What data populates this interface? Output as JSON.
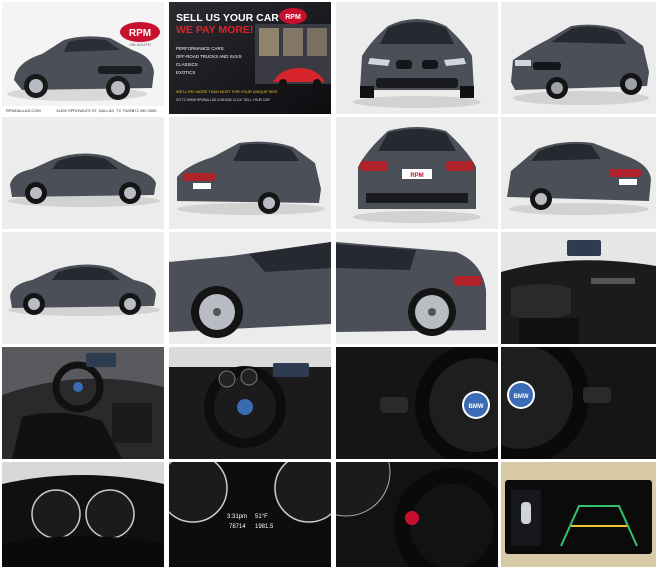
{
  "dealer": {
    "logo_text": "RPM",
    "logo_sub": "ON SOUTH",
    "website": "RPMDALLAS.COM",
    "address": "11450 SPROWLES ST, DALLAS, TX 75229",
    "phone": "972 490 0000"
  },
  "ad": {
    "headline_1": "SELL US YOUR CAR",
    "headline_2": "WE PAY MORE!",
    "categories": [
      "PERFORMANCE CARS",
      "OFF-ROAD TRUCKS AND SUVS",
      "CLASSICS",
      "EXOTICS"
    ],
    "footer_1": "WE'LL PAY MORE THAN MOST FOR YOUR UNIQUE RIDE",
    "footer_2": "GO TO WWW.RPMDALLAS.COM AND CLICK \"SELL YOUR CAR\""
  },
  "cluster": {
    "time": "3:31pm",
    "temp": "51°F",
    "odometer": "78714",
    "trip": "1981.5"
  },
  "steering_badge": "BMW",
  "colors": {
    "car_body": "#4b4f58",
    "interior": "#1b1b1c",
    "studio_bg": "#ececec",
    "ad_red": "#d6262b",
    "ad_yellow": "#f2c12e",
    "screen_green": "#34c26a"
  }
}
